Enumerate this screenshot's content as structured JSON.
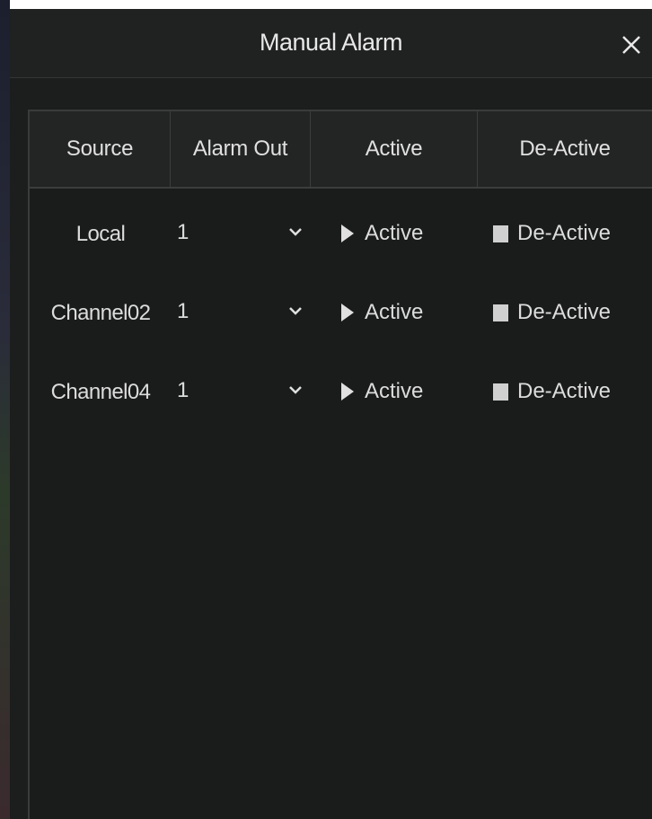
{
  "dialog": {
    "title": "Manual Alarm",
    "close_icon": "close-icon"
  },
  "table": {
    "headers": [
      "Source",
      "Alarm Out",
      "Active",
      "De-Active"
    ],
    "rows": [
      {
        "source": "Local",
        "alarm_out": "1",
        "active_label": "Active",
        "deactive_label": "De-Active"
      },
      {
        "source": "Channel02",
        "alarm_out": "1",
        "active_label": "Active",
        "deactive_label": "De-Active"
      },
      {
        "source": "Channel04",
        "alarm_out": "1",
        "active_label": "Active",
        "deactive_label": "De-Active"
      }
    ]
  },
  "icons": {
    "active": "play-icon",
    "deactive": "stop-icon",
    "dropdown": "chevron-down-icon"
  },
  "colors": {
    "background": "#1c1d1d",
    "header_background": "#232424",
    "text": "#dcdcdc",
    "border": "#3c3d3d"
  }
}
